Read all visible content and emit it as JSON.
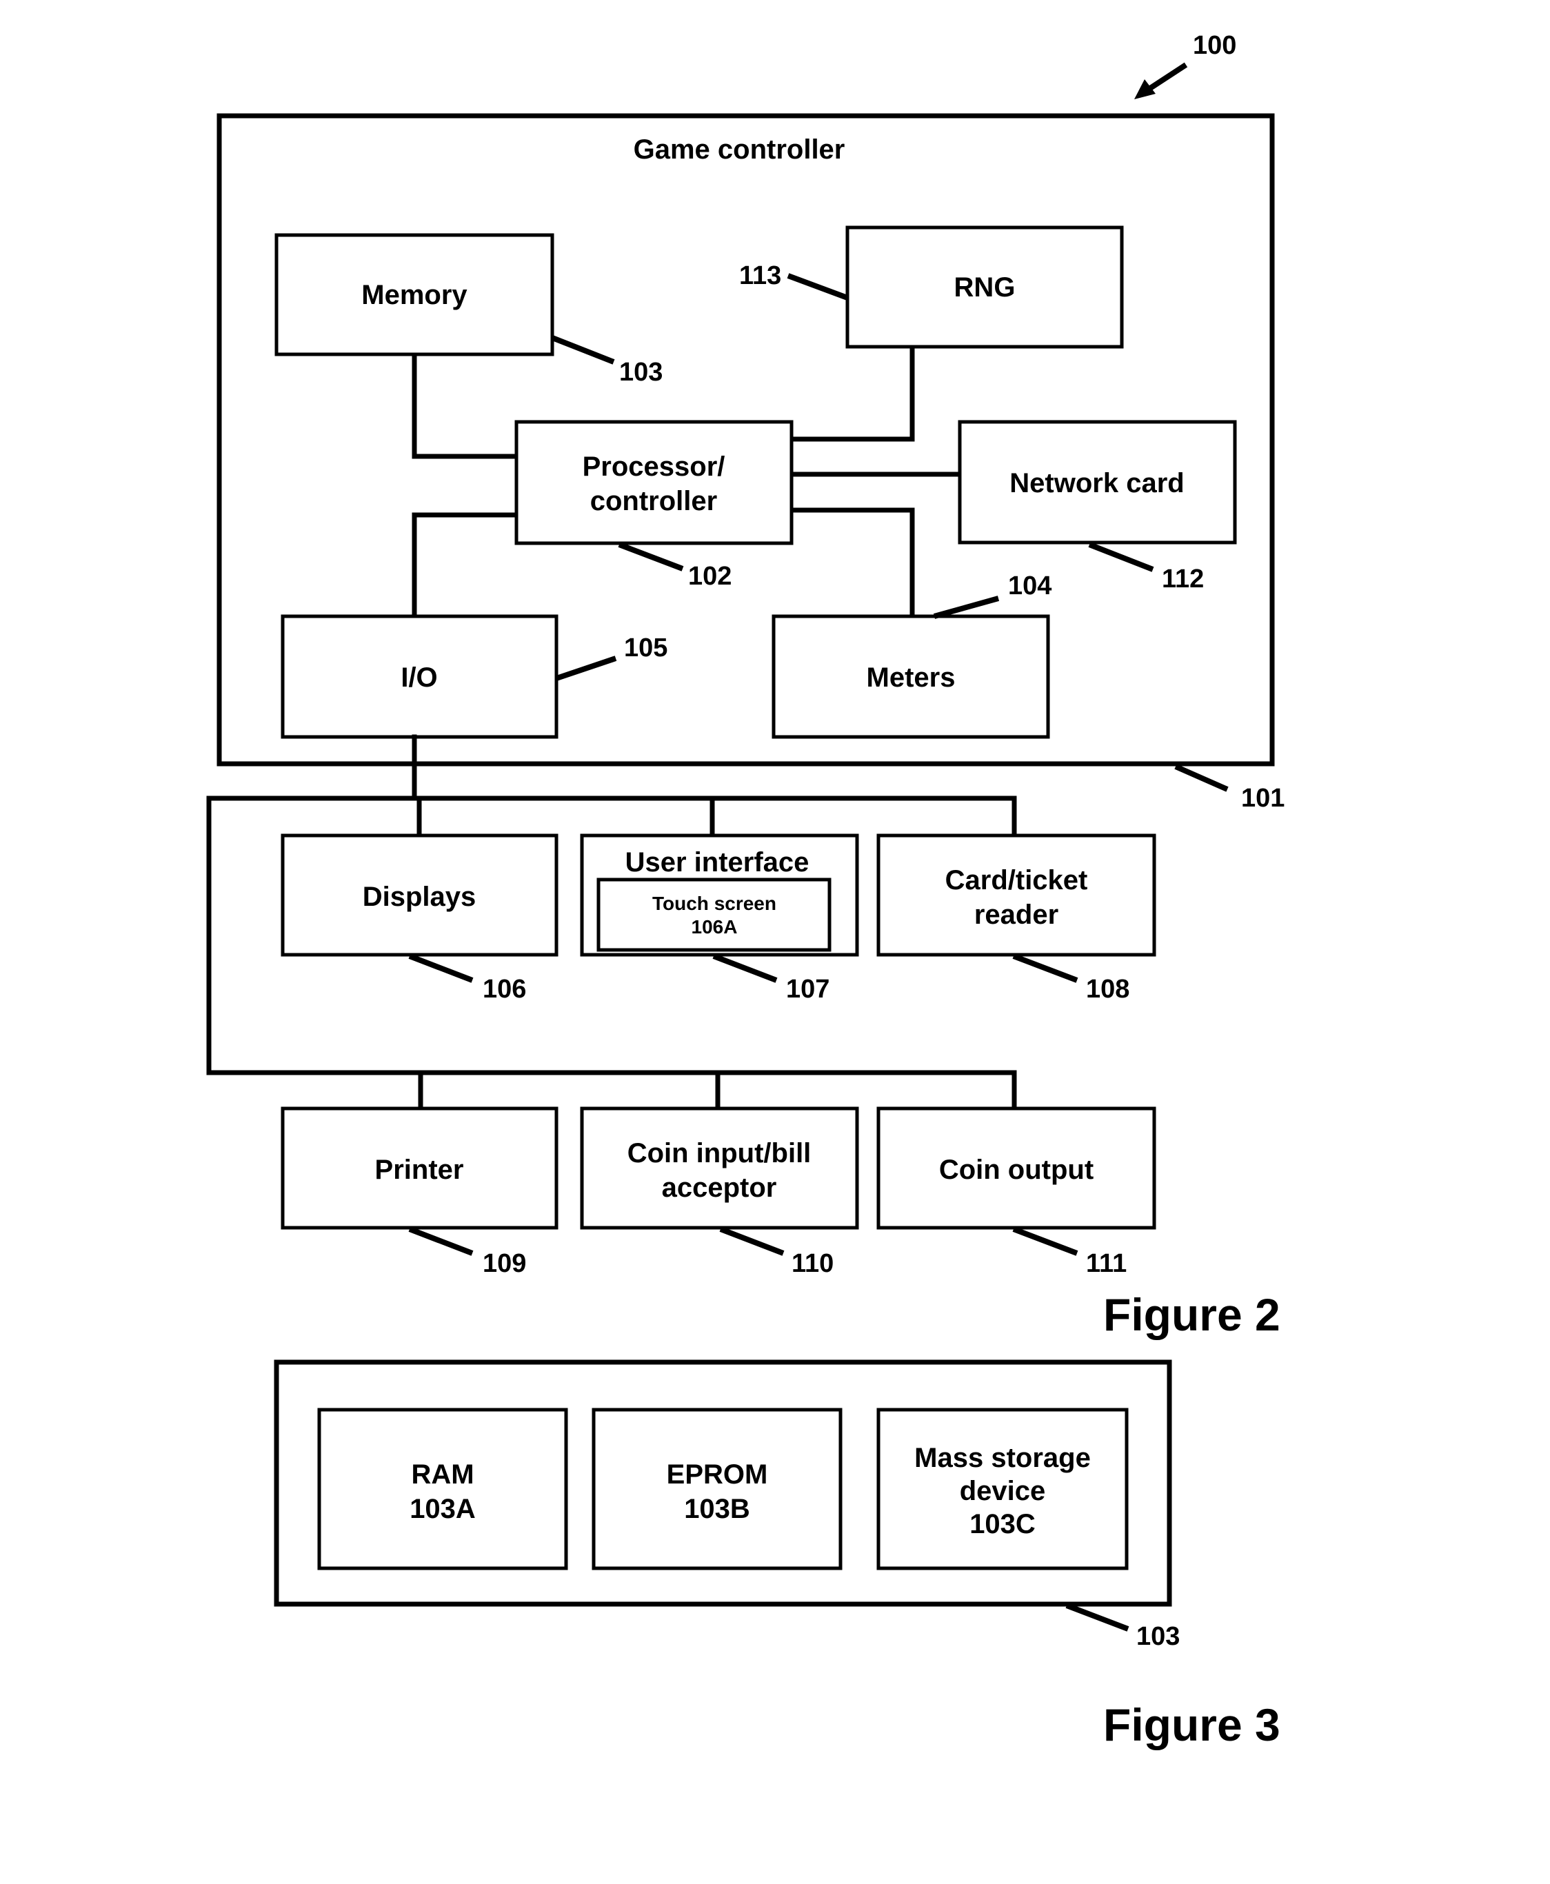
{
  "figure2": {
    "caption": "Figure 2",
    "system_ref": "100",
    "game_controller": {
      "title": "Game controller",
      "ref": "101"
    },
    "blocks": {
      "memory": {
        "label": "Memory",
        "ref": "103"
      },
      "rng": {
        "label": "RNG",
        "ref": "113"
      },
      "processor": {
        "line1": "Processor/",
        "line2": "controller",
        "ref": "102"
      },
      "network_card": {
        "label": "Network card",
        "ref": "112"
      },
      "io": {
        "label": "I/O",
        "ref": "105"
      },
      "meters": {
        "label": "Meters",
        "ref": "104"
      },
      "displays": {
        "label": "Displays",
        "ref": "106"
      },
      "user_interface": {
        "label": "User interface",
        "ref": "107",
        "touch_screen": {
          "line1": "Touch screen",
          "line2": "106A"
        }
      },
      "card_reader": {
        "line1": "Card/ticket",
        "line2": "reader",
        "ref": "108"
      },
      "printer": {
        "label": "Printer",
        "ref": "109"
      },
      "coin_input": {
        "line1": "Coin input/bill",
        "line2": "acceptor",
        "ref": "110"
      },
      "coin_output": {
        "label": "Coin output",
        "ref": "111"
      }
    }
  },
  "figure3": {
    "caption": "Figure 3",
    "memory_ref": "103",
    "blocks": {
      "ram": {
        "line1": "RAM",
        "line2": "103A"
      },
      "eprom": {
        "line1": "EPROM",
        "line2": "103B"
      },
      "mass_storage": {
        "line1": "Mass storage",
        "line2": "device",
        "line3": "103C"
      }
    }
  }
}
